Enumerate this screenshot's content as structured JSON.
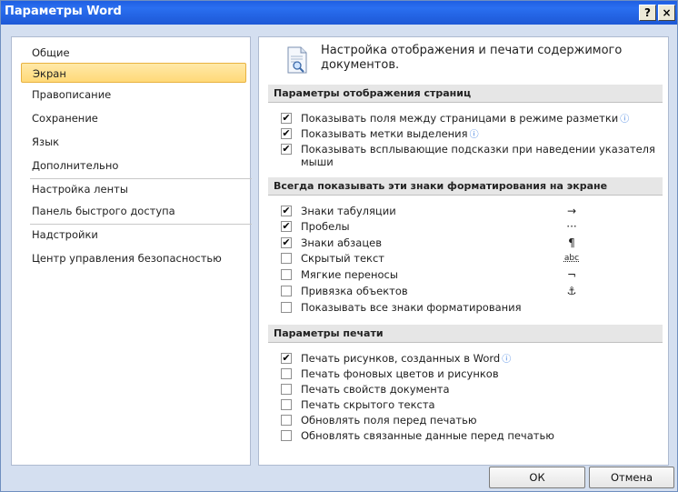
{
  "window": {
    "title": "Параметры Word",
    "help": "?",
    "close": "×"
  },
  "nav": {
    "items": [
      {
        "label": "Общие"
      },
      {
        "label": "Экран",
        "active": true
      },
      {
        "label": "Правописание"
      },
      {
        "label": "Сохранение"
      },
      {
        "label": "Язык"
      },
      {
        "label": "Дополнительно"
      },
      {
        "label": "Настройка ленты"
      },
      {
        "label": "Панель быстрого доступа"
      },
      {
        "label": "Надстройки"
      },
      {
        "label": "Центр управления безопасностью"
      }
    ]
  },
  "header": {
    "text": "Настройка отображения и печати содержимого документов."
  },
  "sections": {
    "display": {
      "title": "Параметры отображения страниц",
      "options": [
        {
          "label": "Показывать поля между страницами в режиме разметки",
          "checked": true,
          "info": true
        },
        {
          "label": "Показывать метки выделения",
          "checked": true,
          "info": true
        },
        {
          "label": "Показывать всплывающие подсказки при наведении указателя мыши",
          "checked": true,
          "info": false
        }
      ]
    },
    "marks": {
      "title": "Всегда показывать эти знаки форматирования на экране",
      "options": [
        {
          "label": "Знаки табуляции",
          "checked": true,
          "symbol": "→"
        },
        {
          "label": "Пробелы",
          "checked": true,
          "symbol": "···"
        },
        {
          "label": "Знаки абзацев",
          "checked": true,
          "symbol": "¶"
        },
        {
          "label": "Скрытый текст",
          "checked": false,
          "symbol": "abc"
        },
        {
          "label": "Мягкие переносы",
          "checked": false,
          "symbol": "¬"
        },
        {
          "label": "Привязка объектов",
          "checked": false,
          "symbol": "⚓"
        },
        {
          "label": "Показывать все знаки форматирования",
          "checked": false,
          "symbol": ""
        }
      ]
    },
    "print": {
      "title": "Параметры печати",
      "options": [
        {
          "label": "Печать рисунков, созданных в Word",
          "checked": true,
          "info": true
        },
        {
          "label": "Печать фоновых цветов и рисунков",
          "checked": false
        },
        {
          "label": "Печать свойств документа",
          "checked": false
        },
        {
          "label": "Печать скрытого текста",
          "checked": false
        },
        {
          "label": "Обновлять поля перед печатью",
          "checked": false
        },
        {
          "label": "Обновлять связанные данные перед печатью",
          "checked": false
        }
      ]
    }
  },
  "buttons": {
    "ok": "ОК",
    "cancel": "Отмена"
  },
  "icons": {
    "info": "info-icon",
    "check": "✔"
  }
}
